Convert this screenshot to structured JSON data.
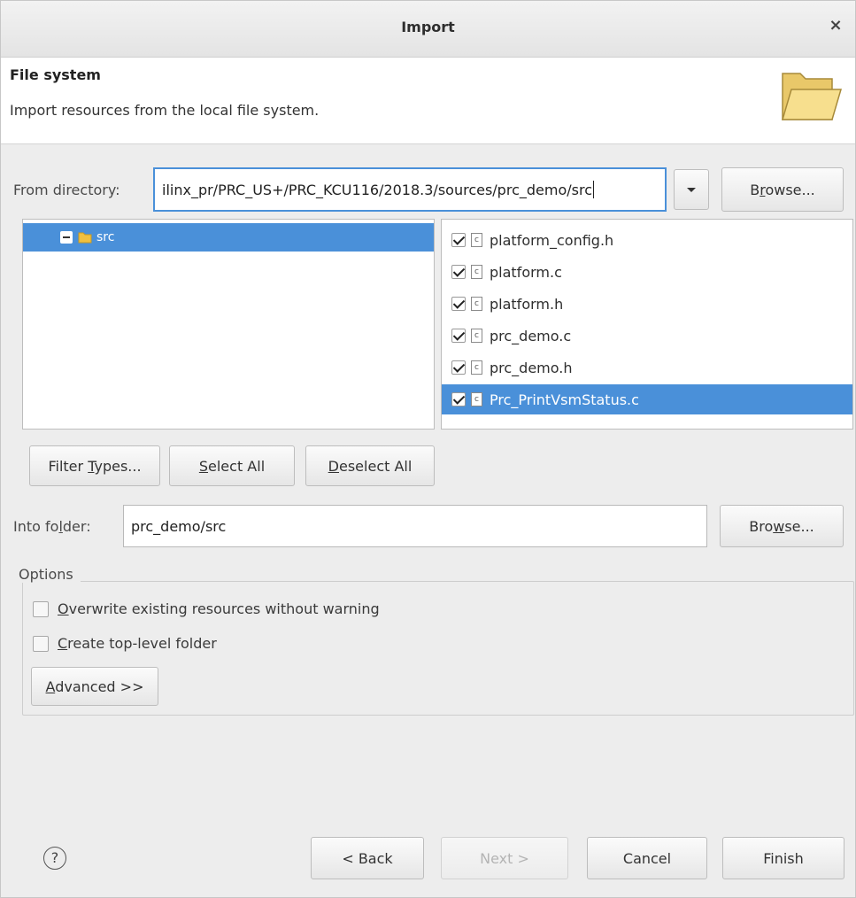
{
  "window": {
    "title": "Import",
    "close_glyph": "×"
  },
  "header": {
    "title": "File system",
    "description": "Import resources from the local file system.",
    "icon": "folder-icon"
  },
  "from_directory": {
    "label": "From directory:",
    "value": "ilinx_pr/PRC_US+/PRC_KCU116/2018.3/sources/prc_demo/src",
    "browse_pre": "B",
    "browse_ul": "r",
    "browse_post": "owse..."
  },
  "tree": {
    "items": [
      {
        "label": "src",
        "expanded": true,
        "selected": true
      }
    ]
  },
  "files": [
    {
      "name": "platform_config.h",
      "checked": true,
      "selected": false
    },
    {
      "name": "platform.c",
      "checked": true,
      "selected": false
    },
    {
      "name": "platform.h",
      "checked": true,
      "selected": false
    },
    {
      "name": "prc_demo.c",
      "checked": true,
      "selected": false
    },
    {
      "name": "prc_demo.h",
      "checked": true,
      "selected": false
    },
    {
      "name": "Prc_PrintVsmStatus.c",
      "checked": true,
      "selected": true
    }
  ],
  "selection_buttons": {
    "filter_pre": "Filter ",
    "filter_ul": "T",
    "filter_post": "ypes...",
    "select_ul": "S",
    "select_post": "elect All",
    "deselect_ul": "D",
    "deselect_post": "eselect All"
  },
  "into_folder": {
    "label_pre": "Into fo",
    "label_ul": "l",
    "label_post": "der:",
    "value": "prc_demo/src",
    "browse_pre": "Bro",
    "browse_ul": "w",
    "browse_post": "se..."
  },
  "options": {
    "legend": "Options",
    "overwrite_ul": "O",
    "overwrite_post": "verwrite existing resources without warning",
    "overwrite_checked": false,
    "toplevel_ul": "C",
    "toplevel_post": "reate top-level folder",
    "toplevel_checked": false,
    "advanced_ul": "A",
    "advanced_post": "dvanced >>"
  },
  "footer": {
    "help_glyph": "?",
    "back": "< Back",
    "next": "Next >",
    "cancel": "Cancel",
    "finish": "Finish"
  },
  "colors": {
    "selection": "#4a90d9",
    "folder": "#f0c040"
  }
}
